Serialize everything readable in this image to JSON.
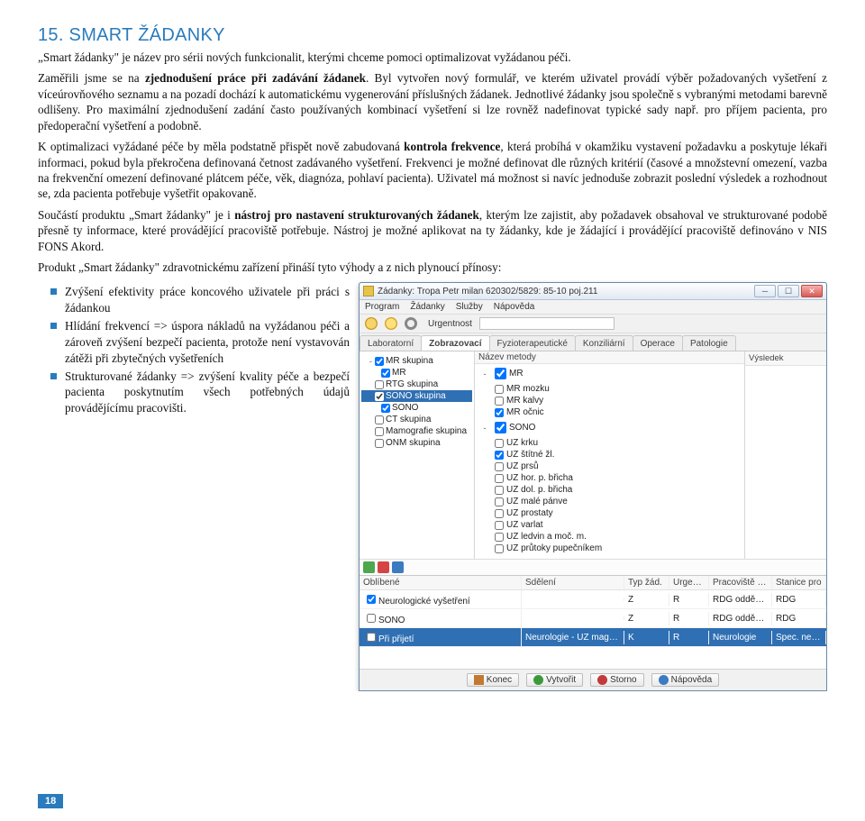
{
  "heading": "15. SMART ŽÁDANKY",
  "p1": "„Smart žádanky\" je název pro sérii nových funkcionalit, kterými chceme pomoci optimalizovat vyžádanou péči.",
  "p2_a": "Zaměřili jsme se na ",
  "p2_b": "zjednodušení práce při zadávání žádanek",
  "p2_c": ". Byl vytvořen nový formulář, ve kterém uživatel provádí výběr požadovaných vyšetření z víceúrovňového seznamu a na pozadí dochází k automatickému vygenerování příslušných žádanek. Jednotlivé žádanky jsou společně s vybranými metodami barevně odlišeny. Pro maximální zjednodušení zadání často používaných kombinací vyšetření si lze rovněž nadefinovat typické sady např. pro příjem pacienta, pro předoperační vyšetření a podobně.",
  "p3_a": "K optimalizaci vyžádané péče by měla podstatně přispět nově zabudovaná ",
  "p3_b": "kontrola frekvence",
  "p3_c": ", která probíhá v okamžiku vystavení požadavku a poskytuje lékaři informaci, pokud byla překročena definovaná četnost zadávaného vyšetření. Frekvenci je možné definovat dle různých kritérií (časové a množstevní omezení, vazba na frekvenční omezení definované plátcem péče, věk, diagnóza, pohlaví pacienta). Uživatel má možnost si navíc jednoduše zobrazit poslední výsledek a rozhodnout se, zda pacienta potřebuje vyšetřit opakovaně.",
  "p4_a": "Součástí produktu „Smart žádanky\" je i ",
  "p4_b": "nástroj pro nastavení strukturovaných žádanek",
  "p4_c": ", kterým lze zajistit, aby požadavek obsahoval ve strukturované podobě přesně ty informace, které provádějící pracoviště potřebuje. Nástroj je možné aplikovat na ty žádanky, kde je žádající i provádějící pracoviště definováno v NIS FONS Akord.",
  "p5": "Produkt „Smart žádanky\" zdravotnickému zařízení přináší tyto výhody a z nich plynoucí přínosy:",
  "bullets": [
    "Zvýšení efektivity práce koncového uživatele při práci s žádankou",
    "Hlídání frekvencí => úspora nákladů na vyžádanou péči a zároveň zvýšení bezpečí pacienta, protože není vystavován zátěži při zbytečných vyšetřeních",
    "Strukturované žádanky => zvýšení kvality péče a bezpečí pacienta poskytnutím všech potřebných údajů provádějícímu pracovišti."
  ],
  "page_number": "18",
  "app": {
    "title": "Žádanky: Tropa Petr milan 620302/5829: 85-10 poj.211",
    "menus": [
      "Program",
      "Žádanky",
      "Služby",
      "Nápověda"
    ],
    "toolbar_urg": "Urgentnost",
    "tabs": [
      "Laboratorní",
      "Zobrazovací",
      "Fyzioterapeutické",
      "Konziliární",
      "Operace",
      "Patologie"
    ],
    "tab_active": 1,
    "left_groups": [
      {
        "expand": "-",
        "checked": true,
        "label": "MR skupina",
        "children": [
          {
            "checked": true,
            "label": "MR"
          }
        ]
      },
      {
        "expand": "",
        "checked": false,
        "label": "RTG skupina",
        "children": []
      },
      {
        "expand": "-",
        "checked": true,
        "label": "SONO skupina",
        "selected": true,
        "children": [
          {
            "checked": true,
            "label": "SONO"
          }
        ]
      },
      {
        "expand": "",
        "checked": false,
        "label": "CT skupina",
        "children": []
      },
      {
        "expand": "",
        "checked": false,
        "label": "Mamografie skupina",
        "children": []
      },
      {
        "expand": "",
        "checked": false,
        "label": "ONM skupina",
        "children": []
      }
    ],
    "mid_head_left": "Název metody",
    "mid_head_right": "Výsledek",
    "mid_sections": [
      {
        "label": "MR",
        "items": [
          {
            "checked": false,
            "label": "MR mozku"
          },
          {
            "checked": false,
            "label": "MR kalvy"
          },
          {
            "checked": true,
            "label": "MR očnic"
          }
        ]
      },
      {
        "label": "SONO",
        "items": [
          {
            "checked": false,
            "label": "UZ krku"
          },
          {
            "checked": true,
            "label": "UZ štítné žl."
          },
          {
            "checked": false,
            "label": "UZ prsů"
          },
          {
            "checked": false,
            "label": "UZ hor. p. břicha"
          },
          {
            "checked": false,
            "label": "UZ dol. p. břicha"
          },
          {
            "checked": false,
            "label": "UZ malé pánve"
          },
          {
            "checked": false,
            "label": "UZ prostaty"
          },
          {
            "checked": false,
            "label": "UZ varlat"
          },
          {
            "checked": false,
            "label": "UZ ledvin a moč. m."
          },
          {
            "checked": false,
            "label": "UZ průtoky pupečníkem"
          }
        ]
      }
    ],
    "grid_head": [
      "Oblíbené",
      "Sdělení",
      "Typ žád.",
      "Urgen…",
      "Pracoviště pro",
      "Stanice pro"
    ],
    "grid_rows": [
      {
        "checked": true,
        "c0": "Neurologické vyšetření",
        "c1": "",
        "c2": "Z",
        "c3": "R",
        "c4": "RDG oddě…",
        "c5": "RDG"
      },
      {
        "checked": false,
        "c0": "SONO",
        "c1": "",
        "c2": "Z",
        "c3": "R",
        "c4": "RDG oddě…",
        "c5": "RDG"
      },
      {
        "checked": false,
        "c0": "Při přijetí",
        "c1": "Neurologie - UZ magistrálních cév Ne…",
        "c2": "K",
        "c3": "R",
        "c4": "Neurologie",
        "c5": "Spec. neur…",
        "selected": true
      }
    ],
    "footer_buttons": [
      {
        "icon": "door",
        "label": "Konec"
      },
      {
        "icon": "check",
        "label": "Vytvořit"
      },
      {
        "icon": "x",
        "label": "Storno"
      },
      {
        "icon": "q",
        "label": "Nápověda"
      }
    ]
  }
}
